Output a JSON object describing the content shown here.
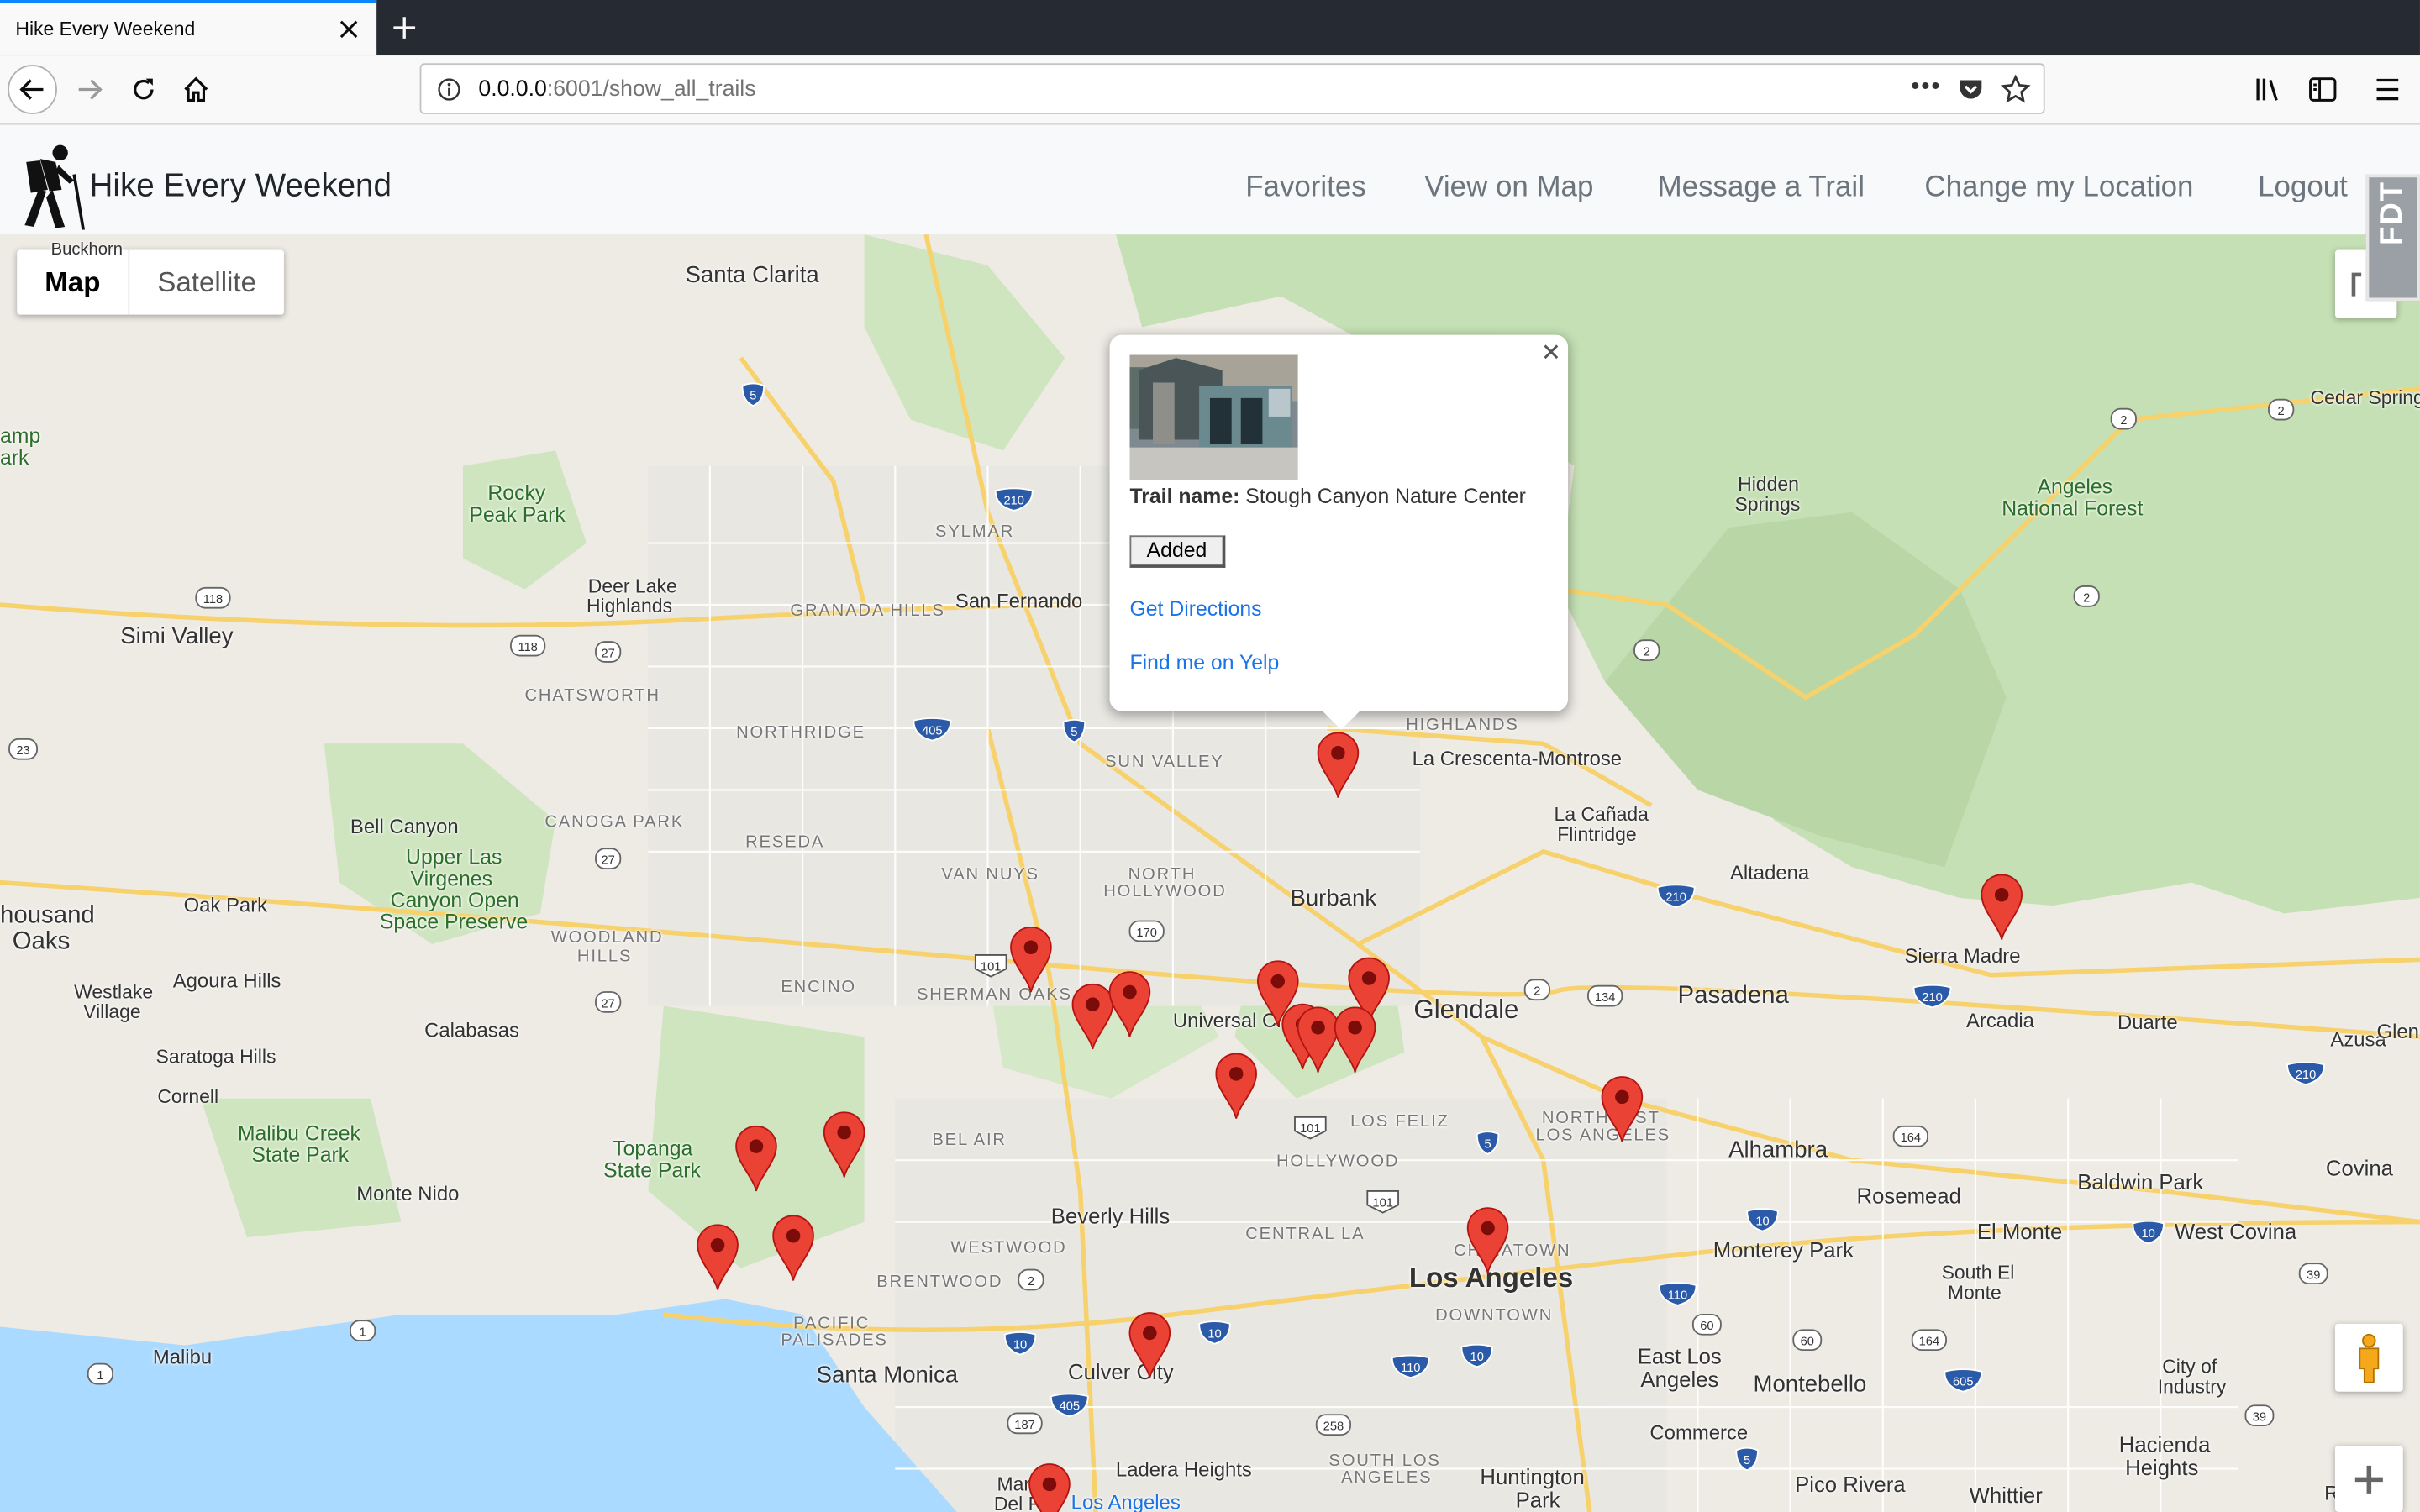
{
  "browser": {
    "tab_title": "Hike Every Weekend",
    "url_host": "0.0.0.0",
    "url_rest": ":6001/show_all_trails"
  },
  "app": {
    "brand": "Hike Every Weekend",
    "nav": [
      "Favorites",
      "View on Map",
      "Message a Trail",
      "Change my Location",
      "Logout"
    ],
    "side_badge": "FDT"
  },
  "map": {
    "type_controls": [
      "Map",
      "Satellite"
    ],
    "labels": {
      "santa_clarita": "Santa Clarita",
      "buckhorn": "Buckhorn",
      "camp_park_1": "amp",
      "camp_park_2": "ark",
      "rocky_peak_1": "Rocky",
      "rocky_peak_2": "Peak Park",
      "deer_lake_1": "Deer Lake",
      "deer_lake_2": "Highlands",
      "sylmar": "SYLMAR",
      "san_fernando": "San Fernando",
      "granada_hills": "GRANADA HILLS",
      "simi_valley": "Simi Valley",
      "chatsworth": "CHATSWORTH",
      "northridge": "NORTHRIDGE",
      "sun_valley": "SUN VALLEY",
      "highlands": "HIGHLANDS",
      "la_crescenta": "La Crescenta-Montrose",
      "hidden_springs_1": "Hidden",
      "hidden_springs_2": "Springs",
      "angeles_nf_1": "Angeles",
      "angeles_nf_2": "National Forest",
      "cedar_springs": "Cedar Spring",
      "bell_canyon": "Bell Canyon",
      "canoga_park": "CANOGA PARK",
      "reseda": "RESEDA",
      "upper_las_1": "Upper Las",
      "upper_las_2": "Virgenes",
      "upper_las_3": "Canyon Open",
      "upper_las_4": "Space Preserve",
      "la_canada_1": "La Cañada",
      "la_canada_2": "Flintridge",
      "altadena": "Altadena",
      "thousand_oaks_1": "housand",
      "thousand_oaks_2": "Oaks",
      "oak_park": "Oak Park",
      "van_nuys": "VAN NUYS",
      "north_hollywood_1": "NORTH",
      "north_hollywood_2": "HOLLYWOOD",
      "burbank": "Burbank",
      "woodland_hills_1": "WOODLAND",
      "woodland_hills_2": "HILLS",
      "sierra_madre": "Sierra Madre",
      "westlake_1": "Westlake",
      "westlake_2": "Village",
      "agoura_hills": "Agoura Hills",
      "encino": "ENCINO",
      "sherman_oaks": "SHERMAN OAKS",
      "universal_city": "Universal Ci",
      "glendale": "Glendale",
      "pasadena": "Pasadena",
      "arcadia": "Arcadia",
      "duarte": "Duarte",
      "azusa": "Azusa",
      "glen": "Glen",
      "calabasas": "Calabasas",
      "saratoga_hills": "Saratoga Hills",
      "cornell": "Cornell",
      "malibu_creek_1": "Malibu Creek",
      "malibu_creek_2": "State Park",
      "topanga_1": "Topanga",
      "topanga_2": "State Park",
      "bel_air": "BEL AIR",
      "los_feliz": "LOS FELIZ",
      "hollywood": "HOLLYWOOD",
      "northeast_la_1": "NORTHEAST",
      "northeast_la_2": "LOS ANGELES",
      "alhambra": "Alhambra",
      "covina": "Covina",
      "baldwin_park": "Baldwin Park",
      "monte_nido": "Monte Nido",
      "beverly_hills": "Beverly Hills",
      "central_la": "CENTRAL LA",
      "rosemead": "Rosemead",
      "westwood": "WESTWOOD",
      "chinatown": "CHINATOWN",
      "monterey_park": "Monterey Park",
      "el_monte": "El Monte",
      "west_covina": "West Covina",
      "brentwood": "BRENTWOOD",
      "los_angeles": "Los Angeles",
      "south_el_monte_1": "South El",
      "south_el_monte_2": "Monte",
      "downtown": "DOWNTOWN",
      "pacific_pal_1": "PACIFIC",
      "pacific_pal_2": "PALISADES",
      "malibu": "Malibu",
      "santa_monica": "Santa Monica",
      "culver_city": "Culver City",
      "east_la_1": "East Los",
      "east_la_2": "Angeles",
      "montebello": "Montebello",
      "city_industry_1": "City of",
      "city_industry_2": "Industry",
      "commerce": "Commerce",
      "hacienda_1": "Hacienda",
      "hacienda_2": "Heights",
      "ladera": "Ladera Heights",
      "south_la_1": "SOUTH LOS",
      "south_la_2": "ANGELES",
      "huntington_1": "Huntington",
      "huntington_2": "Park",
      "pico_rivera": "Pico Rivera",
      "whittier": "Whittier",
      "rowland": "Rowla",
      "marina_1": "Marina",
      "marina_2": "Del Rey",
      "los_angeles_blue": "Los Angeles"
    },
    "shields": [
      "5",
      "210",
      "118",
      "118",
      "27",
      "405",
      "5",
      "23",
      "27",
      "101",
      "170",
      "27",
      "2",
      "134",
      "210",
      "210",
      "210",
      "101",
      "101",
      "5",
      "164",
      "10",
      "10",
      "1",
      "2",
      "10",
      "110",
      "10",
      "187",
      "405",
      "10",
      "110",
      "60",
      "60",
      "164",
      "605",
      "39",
      "39",
      "1",
      "258",
      "5",
      "2",
      "2",
      "2",
      "2"
    ]
  },
  "infowindow": {
    "trail_label": "Trail name:",
    "trail_name": "Stough Canyon Nature Center",
    "button": "Added",
    "link_directions": "Get Directions",
    "link_yelp": "Find me on Yelp"
  }
}
